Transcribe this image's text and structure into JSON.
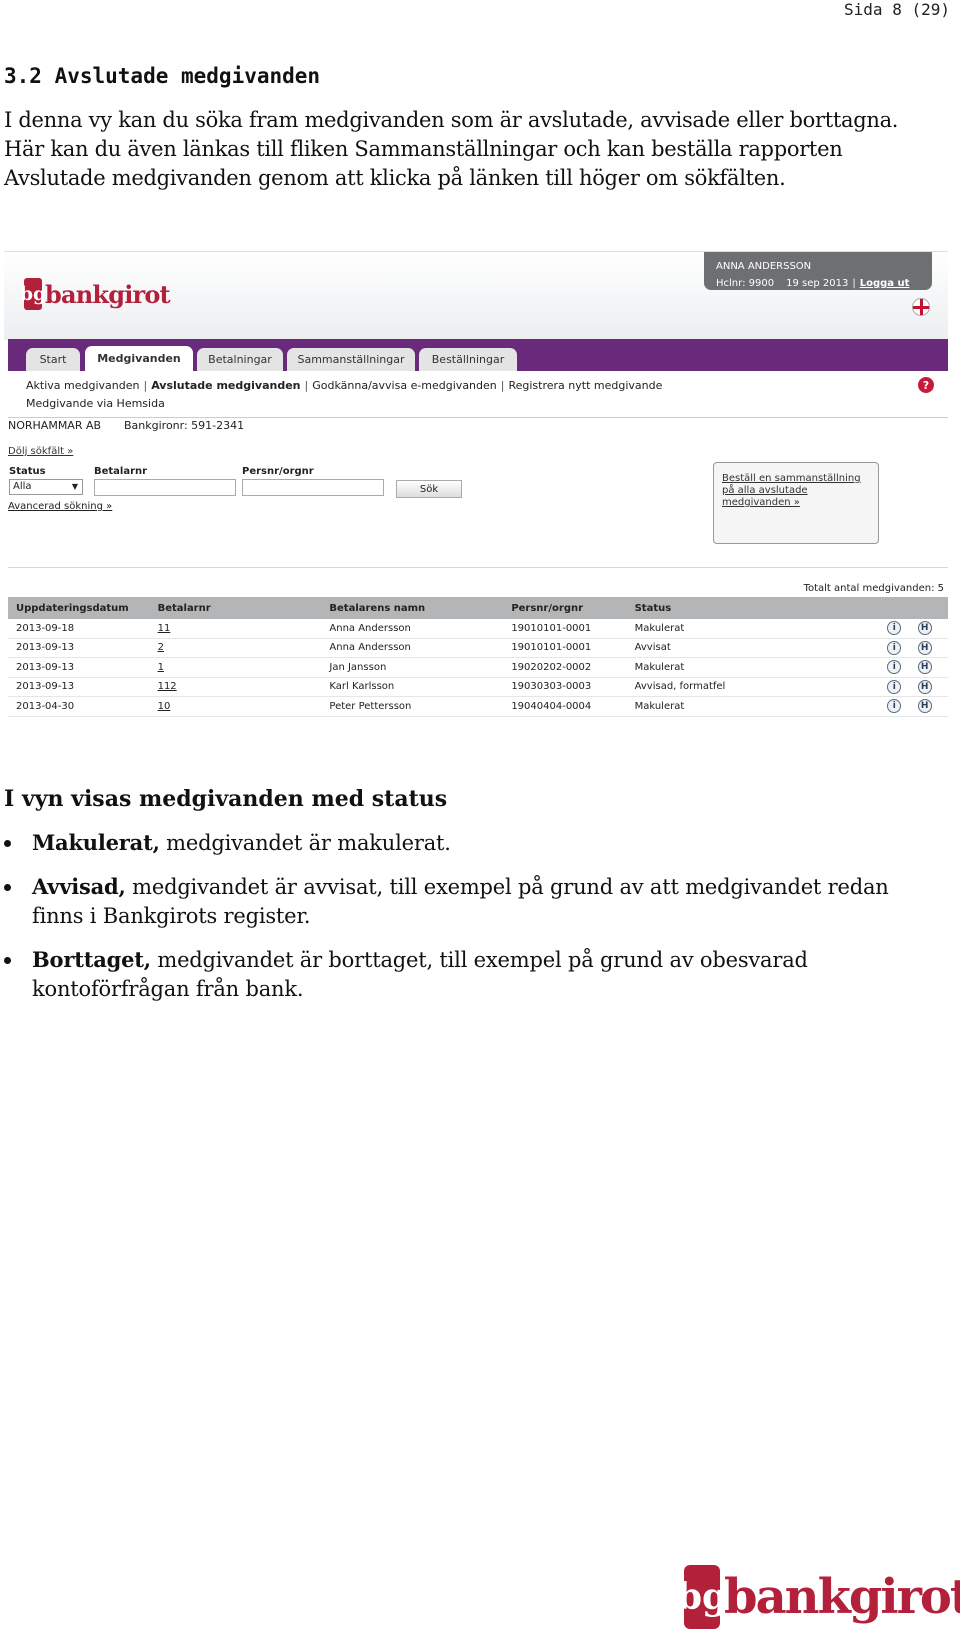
{
  "page": {
    "number": "Sida 8 (29)"
  },
  "section": {
    "title": "3.2  Avslutade medgivanden",
    "intro": "I denna vy kan du söka fram medgivanden som är avslutade, avvisade eller borttagna. Här kan du även länkas till fliken Sammanställningar och kan beställa rapporten Avslutade medgivanden genom att klicka på länken till höger om sökfälten."
  },
  "screenshot": {
    "logo_mark": "bg",
    "logo_text": "bankgirot",
    "user": {
      "name": "ANNA ANDERSSON",
      "hclnr": "Hclnr: 9900",
      "date": "19 sep 2013",
      "separator": "|",
      "logout": "Logga ut"
    },
    "tabs": [
      {
        "label": "Start"
      },
      {
        "label": "Medgivanden"
      },
      {
        "label": "Betalningar"
      },
      {
        "label": "Sammanställningar"
      },
      {
        "label": "Beställningar"
      }
    ],
    "subnav": {
      "items": [
        "Aktiva medgivanden",
        "Avslutade medgivanden",
        "Godkänna/avvisa e-medgivanden",
        "Registrera nytt medgivande"
      ],
      "separator": "|",
      "row2": "Medgivande via Hemsida",
      "help": "?"
    },
    "company": "NORHAMMAR AB",
    "bankgironr": "Bankgironr: 591-2341",
    "hide_search": "Dölj sökfält »",
    "search": {
      "status_label": "Status",
      "status_value": "Alla",
      "betalarnr_label": "Betalarnr",
      "persnr_label": "Persnr/orgnr",
      "button": "Sök"
    },
    "advanced_search": "Avancerad sökning »",
    "order_link": "Beställ en sammanställning på alla avslutade medgivanden »",
    "total": "Totalt antal medgivanden: 5",
    "table": {
      "headers": [
        "Uppdateringsdatum",
        "Betalarnr",
        "Betalarens namn",
        "Persnr/orgnr",
        "Status"
      ],
      "rows": [
        [
          "2013-09-18",
          "11",
          "Anna Andersson",
          "19010101-0001",
          "Makulerat"
        ],
        [
          "2013-09-13",
          "2",
          "Anna Andersson",
          "19010101-0001",
          "Avvisat"
        ],
        [
          "2013-09-13",
          "1",
          "Jan Jansson",
          "19020202-0002",
          "Makulerat"
        ],
        [
          "2013-09-13",
          "112",
          "Karl Karlsson",
          "19030303-0003",
          "Avvisad, formatfel"
        ],
        [
          "2013-04-30",
          "10",
          "Peter Pettersson",
          "19040404-0004",
          "Makulerat"
        ]
      ],
      "info_icon": "i",
      "history_icon": "H"
    }
  },
  "status_section": {
    "heading": "I vyn visas medgivanden med status",
    "items": [
      {
        "term": "Makulerat,",
        "text": " medgivandet är makulerat."
      },
      {
        "term": "Avvisad,",
        "text": " medgivandet är avvisat, till exempel på grund av att medgivandet redan finns i Bankgirots register."
      },
      {
        "term": "Borttaget,",
        "text": " medgivandet är borttaget, till exempel på grund av obesvarad kontoförfrågan från bank."
      }
    ]
  },
  "footer": {
    "logo_mark": "bg",
    "logo_text": "bankgirot"
  },
  "colors": {
    "brand": "#b3203a",
    "nav": "#6a2a7c"
  }
}
